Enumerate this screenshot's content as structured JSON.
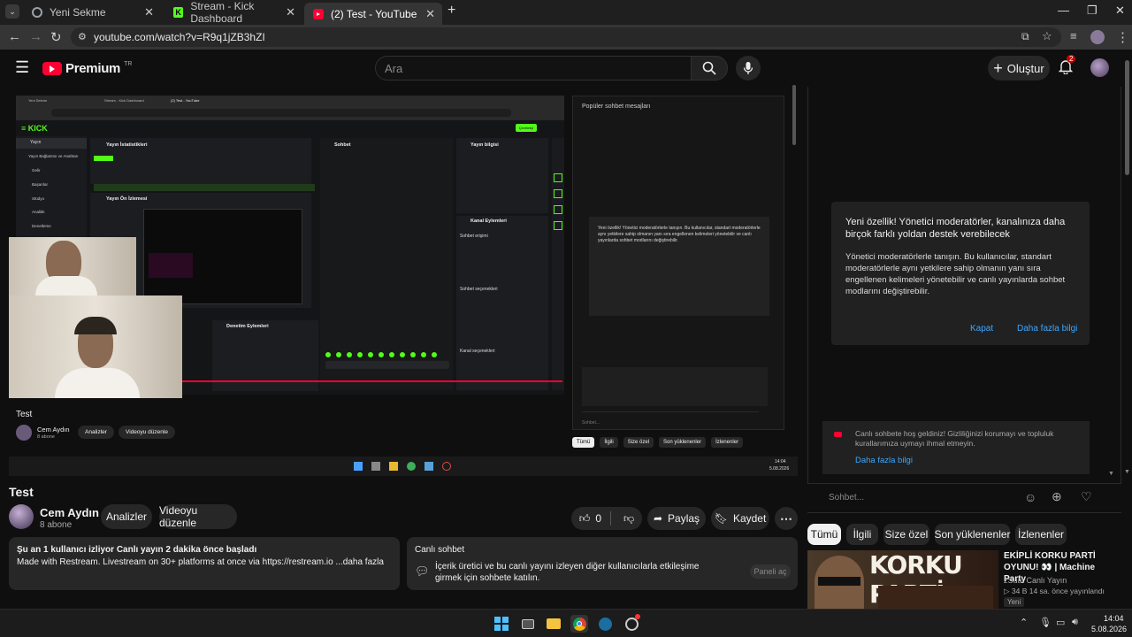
{
  "browser": {
    "tabs": [
      {
        "title": "Yeni Sekme"
      },
      {
        "title": "Stream - Kick Dashboard"
      },
      {
        "title": "(2) Test - YouTube"
      }
    ],
    "url": "youtube.com/watch?v=R9q1jZB3hZI"
  },
  "youtube": {
    "logo": "Premium",
    "logo_sup": "TR",
    "search_placeholder": "Ara",
    "create_label": "Oluştur",
    "notif_count": "2"
  },
  "video": {
    "title": "Test",
    "channel": "Cem Aydın",
    "subs": "8 abone",
    "analytics_label": "Analizler",
    "edit_label": "Videoyu düzenle",
    "like_count": "0",
    "share_label": "Paylaş",
    "save_label": "Kaydet",
    "desc_line1": "Şu an 1 kullanıcı izliyor  Canlı yayın 2 dakika önce başladı",
    "desc_line2": "Made with Restream. Livestream on 30+ platforms at once via https://restream.io ...daha fazla",
    "live_chat_title": "Canlı sohbet",
    "live_chat_desc": "İçerik üretici ve bu canlı yayını izleyen diğer kullanıcılarla etkileşime girmek için sohbete katılın.",
    "panel_open": "Paneli aç"
  },
  "inner_screen": {
    "tabs": [
      "Yeni Sekme",
      "Stream - Kick Dashboard",
      "(2) Test - YouTube"
    ],
    "kick_logo": "KICK",
    "menu": [
      "Yayın",
      "Yayın Bağlantısı ve Anahtarı",
      "Gelir",
      "Başarılar",
      "Stüdyo",
      "Analitik",
      "Denetleme"
    ],
    "stats_title": "Yayın İstatistikleri",
    "chat_title": "Sohbet",
    "info_title": "Yayın bilgisi",
    "preview_title": "Yayın Ön İzlemesi",
    "events_title": "Denetim Eylemleri",
    "channel_actions": "Kanal Eylemleri",
    "chat_access": "Sohbet erişimi",
    "chat_options": "Sohbet seçenekleri",
    "channel_options": "Kanal seçenekleri",
    "live_badge": "Çevrimiçi",
    "popular": "Popüler sohbet mesajları",
    "inner_title": "Test",
    "inner_channel": "Cem Aydın",
    "inner_subs": "8 abone",
    "inner_analytics": "Analizler",
    "inner_edit": "Videoyu düzenle",
    "inner_chips": [
      "Tümü",
      "İlgili",
      "Size özel",
      "Son yüklenenler",
      "İzlenenler"
    ],
    "inner_chat_placeholder": "Sohbet...",
    "inner_clock_time": "14:04",
    "inner_clock_date": "5.08.2026",
    "popup_title": "Yeni özellik! Yönetici moderatörlerle tanışın. Bu kullanıcılar, standart moderatörlerle aynı yetkilere sahip olmanın yanı sıra engellenen kelimeleri yönetebilir ve canlı yayınlarda sohbet modlarını değiştirebilir."
  },
  "chat_panel": {
    "popup_title": "Yeni özellik! Yönetici moderatörler, kanalınıza daha birçok farklı yoldan destek verebilecek",
    "popup_body": "Yönetici moderatörlerle tanışın. Bu kullanıcılar, standart moderatörlerle aynı yetkilere sahip olmanın yanı sıra engellenen kelimeleri yönetebilir ve canlı yayınlarda sohbet modlarını değiştirebilir.",
    "popup_close": "Kapat",
    "popup_more": "Daha fazla bilgi",
    "welcome": "Canlı sohbete hoş geldiniz! Gizliliğinizi korumayı ve topluluk kurallarımıza uymayı ihmal etmeyin.",
    "welcome_more": "Daha fazla bilgi",
    "placeholder": "Sohbet..."
  },
  "filters": [
    "Tümü",
    "İlgili",
    "Size özel",
    "Son yüklenenler",
    "İzlenenler"
  ],
  "recommendation": {
    "title": "EKİPLİ KORKU PARTİ OYUNU! 👀 | Machine Party",
    "thumb_text": "KORKU PARTİ",
    "channel": "zSuat Canlı Yayın",
    "meta": "▷ 34 B  14 sa. önce yayınlandı",
    "badge": "Yeni"
  },
  "taskbar": {
    "time": "14:04",
    "date": "5.08.2026"
  },
  "colors": {
    "kick_green": "#53fc18",
    "yt_red": "#ff0033",
    "link_blue": "#3ea6ff"
  }
}
